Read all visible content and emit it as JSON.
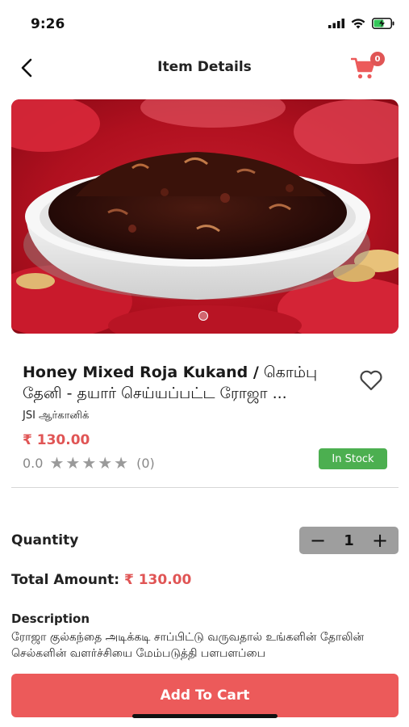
{
  "status": {
    "time": "9:26",
    "icons": [
      "cellular-signal-icon",
      "wifi-icon",
      "battery-charging-icon"
    ]
  },
  "nav": {
    "title": "Item Details",
    "cart_count": "0"
  },
  "product": {
    "title_en": "Honey Mixed Roja Kukand /",
    "title_ta": " கொம்பு தேனி - தயார் செய்யப்பட்ட ரோஜா ...",
    "seller": "JSI ஆர்கானிக்",
    "price": "₹ 130.00",
    "rating_value": "0.0",
    "rating_stars": 0,
    "rating_count": "(0)",
    "stock_status": "In Stock"
  },
  "quantity": {
    "label": "Quantity",
    "value": "1",
    "minus": "−",
    "plus": "+"
  },
  "total": {
    "label": "Total Amount:",
    "amount": "₹ 130.00"
  },
  "description": {
    "title": "Description",
    "text": "ரோஜா குல்கந்தை அடிக்கடி சாப்பிட்டு வருவதால் உங்களின் தோலின் செல்களின் வளர்ச்சியை மேம்படுத்தி பளபளப்பை"
  },
  "footer": {
    "add_to_cart": "Add To Cart"
  },
  "colors": {
    "accent": "#ec5a5a",
    "price": "#e05555",
    "stock": "#4caf50",
    "stepper": "#9e9e9e"
  }
}
